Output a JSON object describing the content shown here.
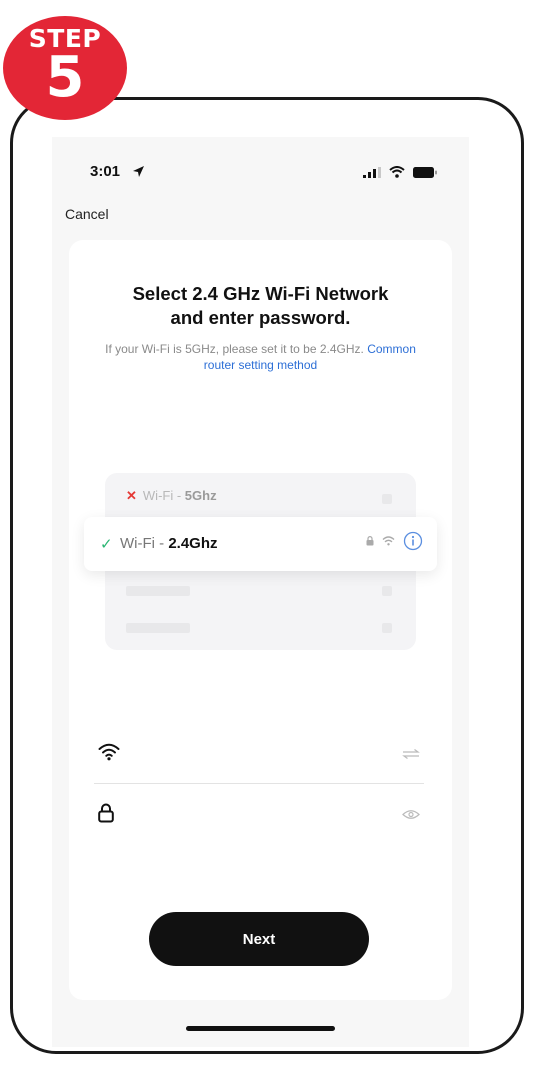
{
  "badge": {
    "label": "STEP",
    "number": "5"
  },
  "status": {
    "time": "3:01"
  },
  "nav": {
    "cancel": "Cancel"
  },
  "title": {
    "line1": "Select 2.4 GHz Wi-Fi Network",
    "line2": "and enter password."
  },
  "subtitle": {
    "text": "If your Wi-Fi is 5GHz, please set it to be 2.4GHz. ",
    "link": "Common router setting method"
  },
  "networks": {
    "bad": {
      "prefix": "Wi-Fi - ",
      "band": "5Ghz"
    },
    "good": {
      "prefix": "Wi-Fi - ",
      "band": "2.4Ghz"
    }
  },
  "fields": {
    "wifi_value": "",
    "password_value": ""
  },
  "actions": {
    "next": "Next"
  },
  "colors": {
    "badge": "#e32636",
    "link": "#2d6fd6",
    "check": "#2bb673",
    "error": "#e53935",
    "button": "#111111"
  }
}
